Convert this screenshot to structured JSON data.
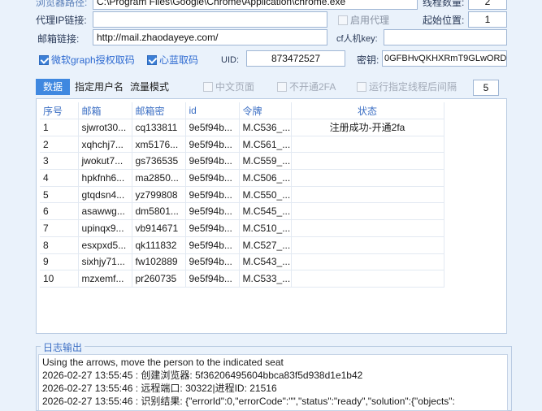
{
  "config": {
    "browser_path_label": "浏览器路径:",
    "browser_path_value": "C:\\Program Files\\Google\\Chrome\\Application\\chrome.exe",
    "thread_count_label": "线程数量:",
    "thread_count_value": "2",
    "proxy_label": "代理IP链接:",
    "proxy_value": "",
    "enable_proxy_label": "启用代理",
    "start_pos_label": "起始位置:",
    "start_pos_value": "1",
    "mail_link_label": "邮箱链接:",
    "mail_link_value": "http://mail.zhaodayeye.com/",
    "cf_key_label": "cf人机key:",
    "cf_key_value": "",
    "ms_graph_label": "微软graph授权取码",
    "xinlan_label": "心蓝取码",
    "uid_label": "UID:",
    "uid_value": "873472527",
    "secret_label": "密钥:",
    "secret_value": "0GFBHvQKHXRmT9GLwORD"
  },
  "tabs": [
    "数据",
    "指定用户名",
    "流量模式"
  ],
  "options": {
    "chinese_page": "中文页面",
    "no_2fa": "不开通2FA",
    "run_after_label": "运行指定线程后间隔",
    "run_after_value": "5"
  },
  "table": {
    "headers": [
      "序号",
      "邮箱",
      "邮箱密",
      "id",
      "令牌",
      "状态"
    ],
    "rows": [
      [
        "1",
        "sjwrot30...",
        "cq133811",
        "9e5f94b...",
        "M.C536_...",
        "注册成功-开通2fa"
      ],
      [
        "2",
        "xqhchj7...",
        "xm5176...",
        "9e5f94b...",
        "M.C561_...",
        ""
      ],
      [
        "3",
        "jwokut7...",
        "gs736535",
        "9e5f94b...",
        "M.C559_...",
        ""
      ],
      [
        "4",
        "hpkfnh6...",
        "ma2850...",
        "9e5f94b...",
        "M.C506_...",
        ""
      ],
      [
        "5",
        "gtqdsn4...",
        "yz799808",
        "9e5f94b...",
        "M.C550_...",
        ""
      ],
      [
        "6",
        "asawwg...",
        "dm5801...",
        "9e5f94b...",
        "M.C545_...",
        ""
      ],
      [
        "7",
        "upinqx9...",
        "vb914671",
        "9e5f94b...",
        "M.C510_...",
        ""
      ],
      [
        "8",
        "esxpxd5...",
        "qk111832",
        "9e5f94b...",
        "M.C527_...",
        ""
      ],
      [
        "9",
        "sixhjy71...",
        "fw102889",
        "9e5f94b...",
        "M.C543_...",
        ""
      ],
      [
        "10",
        "mzxemf...",
        "pr260735",
        "9e5f94b...",
        "M.C533_...",
        ""
      ]
    ]
  },
  "log": {
    "title": "日志输出",
    "lines": [
      "Using the arrows, move the person to the indicated seat",
      "2026-02-27 13:55:45 : 创建浏览器: 5f36206495604bbca83f5d938d1e1b42",
      "2026-02-27 13:55:46 : 远程端口: 30322|进程ID: 21516",
      "2026-02-27 13:55:46 : 识别结果: {\"errorId\":0,\"errorCode\":\"\",\"status\":\"ready\",\"solution\":{\"objects\":"
    ]
  }
}
